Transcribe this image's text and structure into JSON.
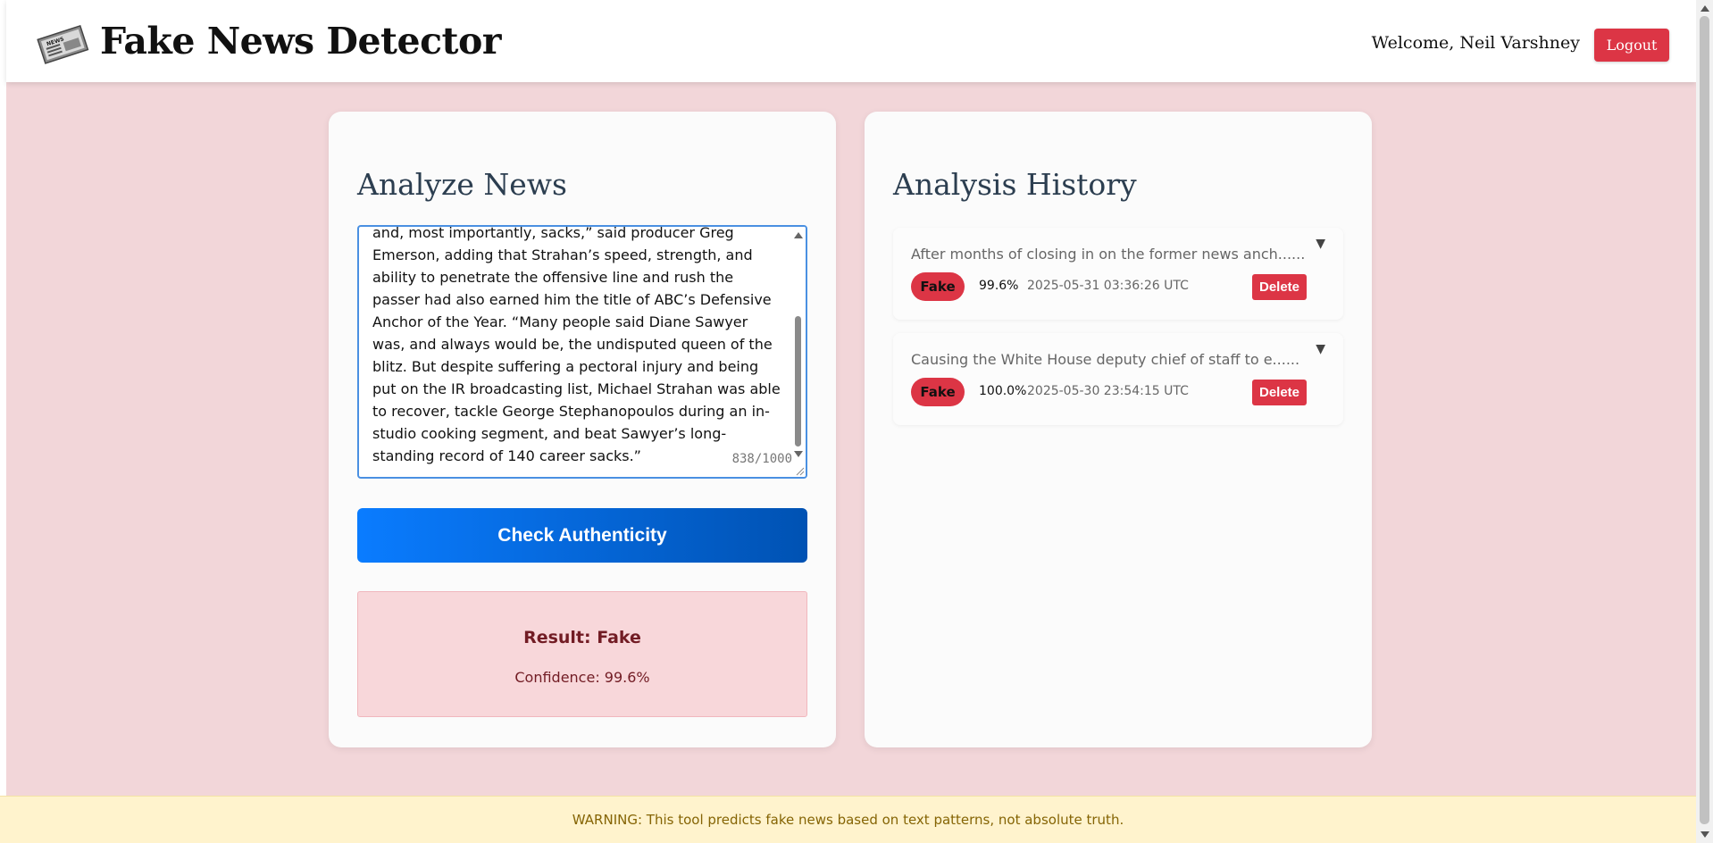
{
  "header": {
    "title": "Fake News Detector",
    "logo_icon": "newspaper-icon",
    "logo_text": "NEWS",
    "welcome": "Welcome, Neil Varshney",
    "logout_label": "Logout"
  },
  "analyze": {
    "title": "Analyze News",
    "text_value": "and, most importantly, sacks,” said producer Greg Emerson, adding that Strahan’s speed, strength, and ability to penetrate the offensive line and rush the passer had also earned him the title of ABC’s Defensive Anchor of the Year. “Many people said Diane Sawyer was, and always would be, the undisputed queen of the blitz. But despite suffering a pectoral injury and being put on the IR broadcasting list, Michael Strahan was able to recover, tackle George Stephanopoulos during an in-studio cooking segment, and beat Sawyer’s long-standing record of 140 career sacks.”",
    "char_count": "838/1000",
    "check_button": "Check Authenticity",
    "result": "Result: Fake",
    "confidence": "Confidence: 99.6%"
  },
  "history": {
    "title": "Analysis History",
    "items": [
      {
        "text": "After months of closing in on the former news anch......",
        "label": "Fake",
        "confidence": "99.6%",
        "timestamp": "2025-05-31 03:36:26 UTC",
        "delete_label": "Delete",
        "toggle": "▼"
      },
      {
        "text": "Causing the White House deputy chief of staff to e......",
        "label": "Fake",
        "confidence": "100.0%",
        "timestamp": "2025-05-30 23:54:15 UTC",
        "delete_label": "Delete",
        "toggle": "▼"
      }
    ]
  },
  "footer": {
    "warning": "WARNING: This tool predicts fake news based on text patterns, not absolute truth."
  },
  "colors": {
    "background": "#f2d6d9",
    "danger": "#dc3545",
    "primary": "#0a7cff",
    "heading": "#2c3e50",
    "warning_bg": "#fff3cd"
  }
}
